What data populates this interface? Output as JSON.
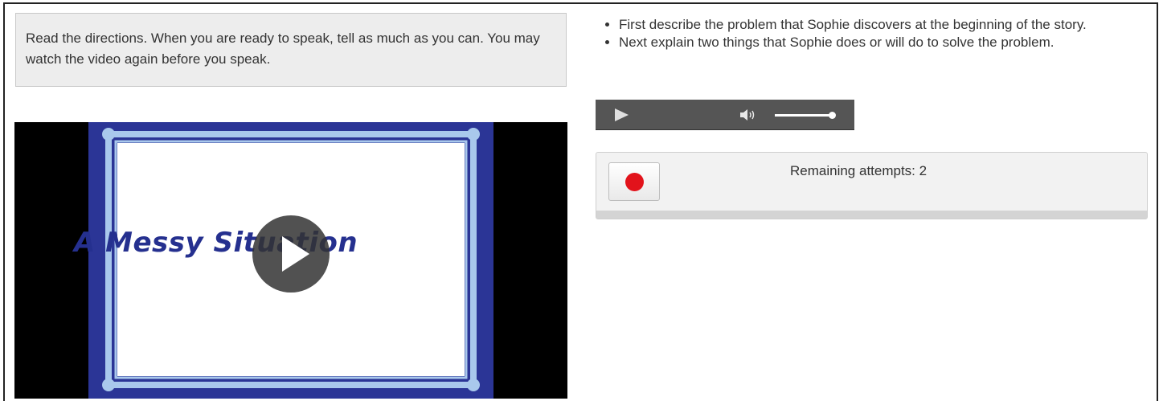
{
  "directions": {
    "text": "Read the directions. When you are ready to speak, tell as much as you can. You may watch the video again before you speak."
  },
  "video": {
    "slide_title": "A Messy Situation",
    "play_icon": "play-icon"
  },
  "instructions": {
    "items": [
      "First describe the problem that Sophie discovers at the beginning of the story.",
      "Next explain two things that Sophie does or will do to solve the problem."
    ]
  },
  "audio_player": {
    "play_icon": "play-icon",
    "volume_icon": "speaker-icon",
    "volume_level": 1.0
  },
  "recorder": {
    "record_icon": "record-icon",
    "status": "Remaining attempts: 2",
    "record_color": "#e2131b"
  },
  "colors": {
    "slide_border_dark": "#2b3596",
    "slide_border_light": "#a9c8ec",
    "title_color": "#25308f"
  }
}
